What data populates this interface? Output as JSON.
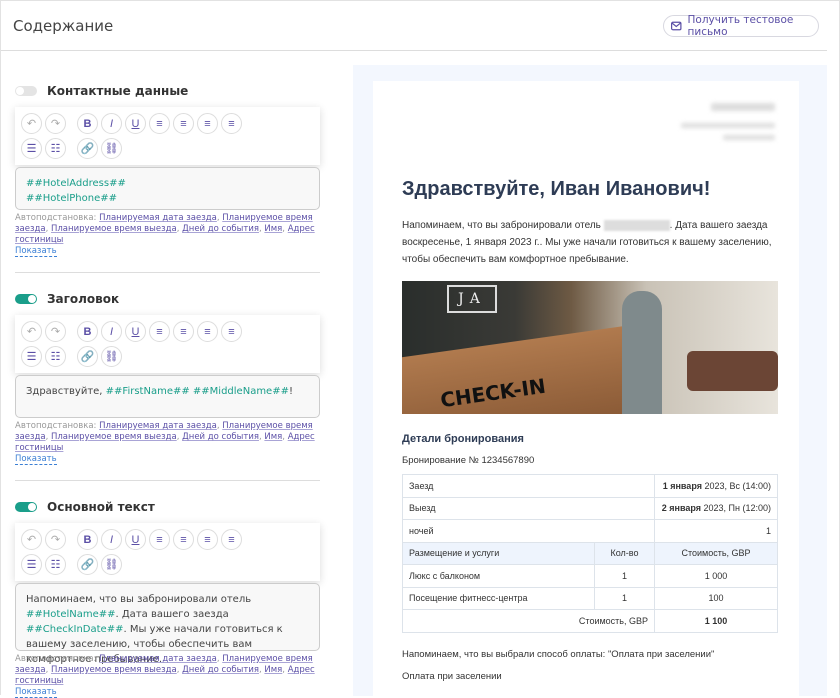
{
  "header": {
    "title": "Содержание",
    "test_button": "Получить тестовое письмо"
  },
  "sections": [
    {
      "title": "Контактные данные",
      "enabled": false,
      "content": [
        [
          "ph",
          "##HotelAddress##"
        ],
        [
          "br",
          ""
        ],
        [
          "ph",
          "##HotelPhone##"
        ]
      ]
    },
    {
      "title": "Заголовок",
      "enabled": true,
      "content": [
        [
          "t",
          "Здравствуйте, "
        ],
        [
          "ph",
          "##FirstName##"
        ],
        [
          "t",
          " "
        ],
        [
          "ph",
          "##MiddleName##"
        ],
        [
          "t",
          "!"
        ]
      ]
    },
    {
      "title": "Основной текст",
      "enabled": true,
      "content": [
        [
          "t",
          "Напоминаем, что вы забронировали отель "
        ],
        [
          "ph",
          "##HotelName##"
        ],
        [
          "t",
          ". Дата вашего заезда "
        ],
        [
          "ph",
          "##CheckInDate##"
        ],
        [
          "t",
          ". Мы уже начали готовиться к вашему заселению, чтобы обеспечить вам комфортное пребывание."
        ]
      ]
    }
  ],
  "autosub": {
    "label": "Автоподстановка:",
    "links": [
      "Планируемая дата заезда",
      "Планируемое время заезда",
      "Планируемое время выезда",
      "Дней до события",
      "Имя",
      "Адрес гостиницы"
    ],
    "show": "Показать"
  },
  "toolbar": {
    "buttons": [
      [
        "undo-icon",
        "↶"
      ],
      [
        "redo-icon",
        "↷"
      ],
      [
        "bold-icon",
        "B"
      ],
      [
        "italic-icon",
        "I"
      ],
      [
        "underline-icon",
        "U"
      ],
      [
        "align-left-icon",
        "≡"
      ],
      [
        "align-center-icon",
        "≡"
      ],
      [
        "align-right-icon",
        "≡"
      ],
      [
        "align-justify-icon",
        "≡"
      ],
      [
        "bullet-list-icon",
        "☰"
      ],
      [
        "numbered-list-icon",
        "☷"
      ],
      [
        "link-icon",
        "🔗"
      ],
      [
        "unlink-icon",
        "⛓"
      ]
    ]
  },
  "preview": {
    "greeting": "Здравствуйте, Иван Иванович!",
    "intro_a": "Напоминаем, что вы забронировали отель ",
    "intro_b": ". Дата вашего заезда воскресенье, 1 января 2023 г.. Мы уже начали готовиться к вашему заселению, чтобы обеспечить вам комфортное пребывание.",
    "photo_sign": "JA",
    "photo_checkin": "CHECK-IN",
    "details_title": "Детали бронирования",
    "booking": "Бронирование № 1234567890",
    "checkin_label": "Заезд",
    "checkin_bold": "1 января",
    "checkin_rest": " 2023, Вс (14:00)",
    "checkout_label": "Выезд",
    "checkout_bold": "2 января",
    "checkout_rest": " 2023, Пн (12:00)",
    "nights_label": "ночей",
    "nights": "1",
    "col_service": "Размещение и услуги",
    "col_qty": "Кол-во",
    "col_cost": "Стоимость, GBP",
    "rows": [
      {
        "name": "Люкс с балконом",
        "qty": "1",
        "cost": "1 000"
      },
      {
        "name": "Посещение фитнесс-центра",
        "qty": "1",
        "cost": "100"
      }
    ],
    "total_label": "Стоимость, GBP",
    "total": "1 100",
    "payment_note": "Напоминаем, что вы выбрали способ оплаты: \"Оплата при заселении\"",
    "payment": "Оплата при заселении"
  },
  "colors": {
    "accent": "#5b4fa6",
    "toggle_on": "#1a9e8a",
    "toggle_off": "#e4e4e4",
    "placeholder": "#1a9e8a"
  }
}
